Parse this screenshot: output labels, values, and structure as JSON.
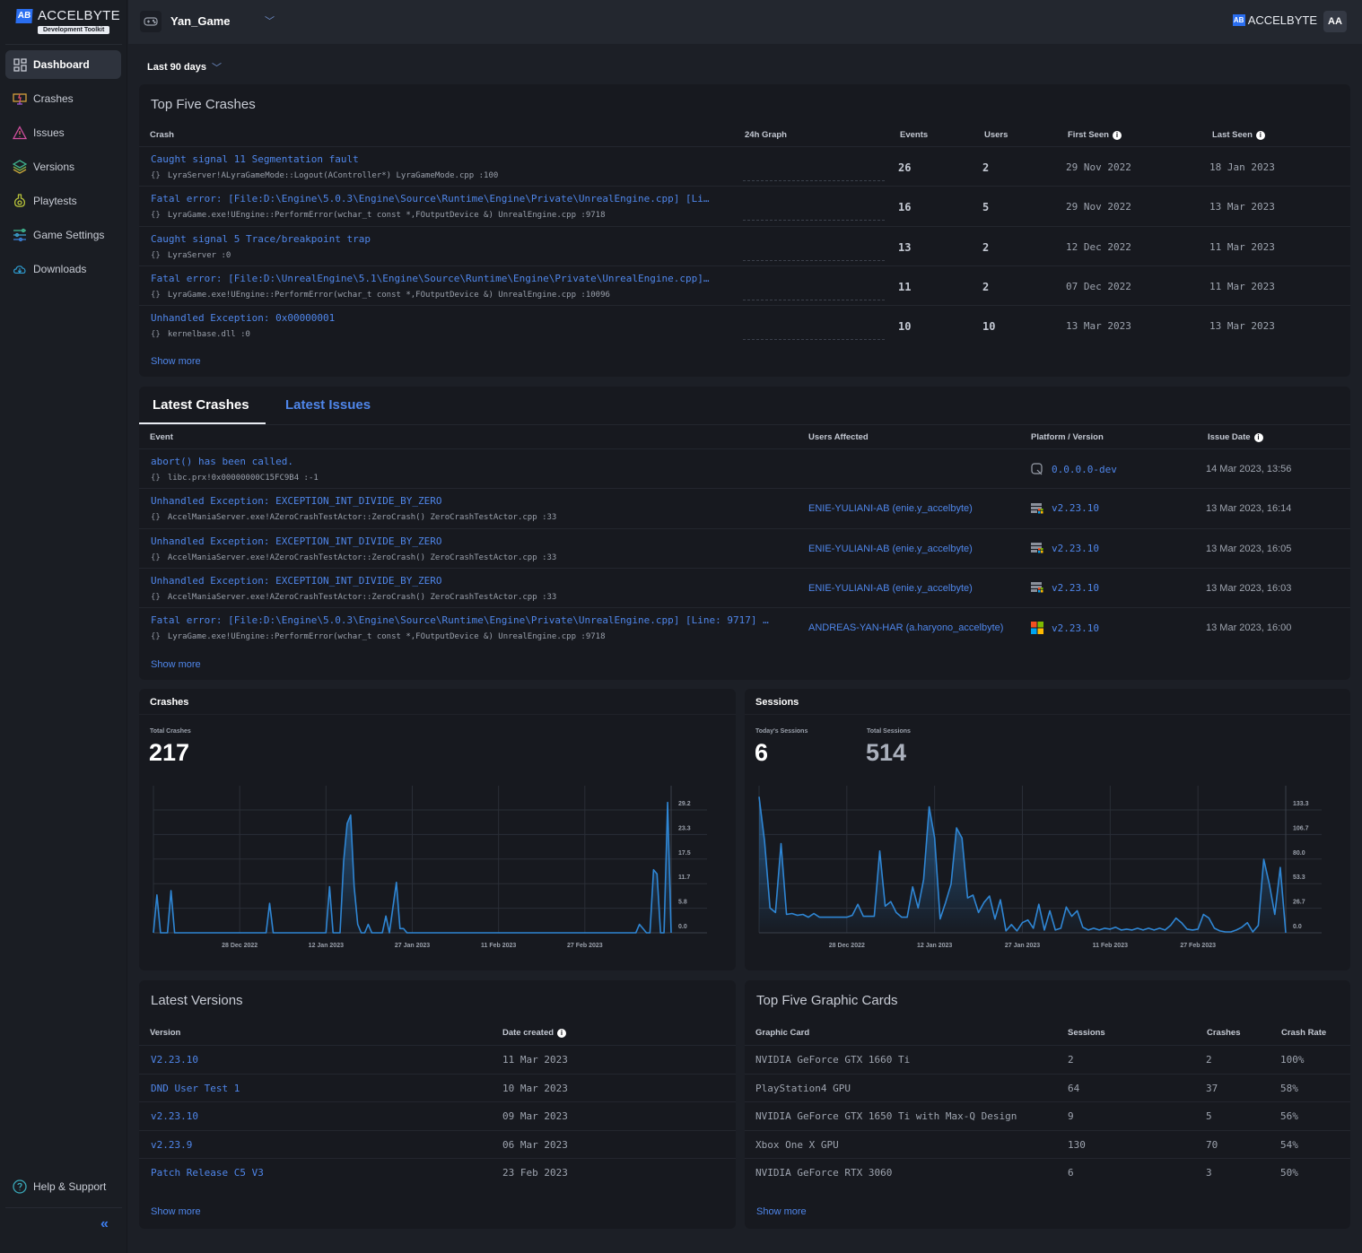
{
  "sidebar": {
    "brand": "ACCELBYTE",
    "brand_badge": "Development Toolkit",
    "items": [
      {
        "label": "Dashboard",
        "icon": "dashboard-icon",
        "active": true
      },
      {
        "label": "Crashes",
        "icon": "crashes-icon"
      },
      {
        "label": "Issues",
        "icon": "warning-icon"
      },
      {
        "label": "Versions",
        "icon": "layers-icon"
      },
      {
        "label": "Playtests",
        "icon": "flask-icon"
      },
      {
        "label": "Game Settings",
        "icon": "sliders-icon"
      },
      {
        "label": "Downloads",
        "icon": "cloud-download-icon"
      }
    ],
    "help": "Help & Support",
    "collapse": "«"
  },
  "topbar": {
    "game": "Yan_Game",
    "brand": "ACCELBYTE",
    "avatar": "AA"
  },
  "range": "Last 90 days",
  "top_crashes": {
    "title": "Top Five Crashes",
    "headers": {
      "crash": "Crash",
      "graph": "24h Graph",
      "events": "Events",
      "users": "Users",
      "first": "First Seen",
      "last": "Last Seen"
    },
    "rows": [
      {
        "title": "Caught signal 11 Segmentation fault",
        "sub": "LyraServer!ALyraGameMode::Logout(AController*) LyraGameMode.cpp :100",
        "events": "26",
        "users": "2",
        "first": "29 Nov 2022",
        "last": "18 Jan 2023"
      },
      {
        "title": "Fatal error: [File:D:\\Engine\\5.0.3\\Engine\\Source\\Runtime\\Engine\\Private\\UnrealEngine.cpp] [Li…",
        "sub": "LyraGame.exe!UEngine::PerformError(wchar_t const *,FOutputDevice &) UnrealEngine.cpp :9718",
        "events": "16",
        "users": "5",
        "first": "29 Nov 2022",
        "last": "13 Mar 2023"
      },
      {
        "title": "Caught signal 5 Trace/breakpoint trap",
        "sub": "LyraServer :0",
        "events": "13",
        "users": "2",
        "first": "12 Dec 2022",
        "last": "11 Mar 2023"
      },
      {
        "title": "Fatal error: [File:D:\\UnrealEngine\\5.1\\Engine\\Source\\Runtime\\Engine\\Private\\UnrealEngine.cpp]…",
        "sub": "LyraGame.exe!UEngine::PerformError(wchar_t const *,FOutputDevice &) UnrealEngine.cpp :10096",
        "events": "11",
        "users": "2",
        "first": "07 Dec 2022",
        "last": "11 Mar 2023"
      },
      {
        "title": "Unhandled Exception: 0x00000001",
        "sub": "kernelbase.dll :0",
        "events": "10",
        "users": "10",
        "first": "13 Mar 2023",
        "last": "13 Mar 2023"
      }
    ],
    "show_more": "Show more"
  },
  "latest": {
    "tabs": [
      "Latest Crashes",
      "Latest Issues"
    ],
    "headers": {
      "event": "Event",
      "users": "Users Affected",
      "platform": "Platform / Version",
      "date": "Issue Date"
    },
    "rows": [
      {
        "title": "abort() has been called.",
        "sub": "libc.prx!0x00000000C15FC9B4 :-1",
        "user": "",
        "platform": "playstation-icon",
        "version": "0.0.0.0-dev",
        "date": "14 Mar 2023, 13:56"
      },
      {
        "title": "Unhandled Exception: EXCEPTION_INT_DIVIDE_BY_ZERO",
        "sub": "AccelManiaServer.exe!AZeroCrashTestActor::ZeroCrash() ZeroCrashTestActor.cpp :33",
        "user": "ENIE-YULIANI-AB (enie.y_accelbyte)",
        "platform": "windows-server-icon",
        "version": "v2.23.10",
        "date": "13 Mar 2023, 16:14"
      },
      {
        "title": "Unhandled Exception: EXCEPTION_INT_DIVIDE_BY_ZERO",
        "sub": "AccelManiaServer.exe!AZeroCrashTestActor::ZeroCrash() ZeroCrashTestActor.cpp :33",
        "user": "ENIE-YULIANI-AB (enie.y_accelbyte)",
        "platform": "windows-server-icon",
        "version": "v2.23.10",
        "date": "13 Mar 2023, 16:05"
      },
      {
        "title": "Unhandled Exception: EXCEPTION_INT_DIVIDE_BY_ZERO",
        "sub": "AccelManiaServer.exe!AZeroCrashTestActor::ZeroCrash() ZeroCrashTestActor.cpp :33",
        "user": "ENIE-YULIANI-AB (enie.y_accelbyte)",
        "platform": "windows-server-icon",
        "version": "v2.23.10",
        "date": "13 Mar 2023, 16:03"
      },
      {
        "title": "Fatal error: [File:D:\\Engine\\5.0.3\\Engine\\Source\\Runtime\\Engine\\Private\\UnrealEngine.cpp] [Line: 9717] …",
        "sub": "LyraGame.exe!UEngine::PerformError(wchar_t const *,FOutputDevice &) UnrealEngine.cpp :9718",
        "user": "ANDREAS-YAN-HAR (a.haryono_accelbyte)",
        "platform": "windows-icon",
        "version": "v2.23.10",
        "date": "13 Mar 2023, 16:00"
      }
    ],
    "show_more": "Show more"
  },
  "crashes_panel": {
    "title": "Crashes",
    "total_label": "Total Crashes",
    "total": "217"
  },
  "sessions_panel": {
    "title": "Sessions",
    "today_label": "Today's Sessions",
    "today": "6",
    "total_label": "Total Sessions",
    "total": "514"
  },
  "chart_data": [
    {
      "type": "area",
      "title": "Crashes",
      "x_ticks": [
        "28 Dec 2022",
        "12 Jan 2023",
        "27 Jan 2023",
        "11 Feb 2023",
        "27 Feb 2023"
      ],
      "y_ticks": [
        "0.0",
        "5.8",
        "11.7",
        "17.5",
        "23.3",
        "29.2"
      ],
      "ylim": [
        0,
        35
      ],
      "grid": true,
      "color": "#2f86d4",
      "values": [
        0,
        9,
        0,
        0,
        0,
        10,
        0,
        0,
        0,
        0,
        0,
        0,
        0,
        0,
        0,
        0,
        0,
        0,
        0,
        0,
        0,
        0,
        0,
        0,
        0,
        0,
        0,
        0,
        0,
        0,
        0,
        0,
        0,
        7,
        0,
        0,
        0,
        0,
        0,
        0,
        0,
        0,
        0,
        0,
        0,
        0,
        0,
        0,
        0,
        0,
        11,
        0,
        0,
        0,
        17,
        26,
        28,
        11,
        2,
        0,
        0,
        2,
        0,
        0,
        0,
        0,
        4,
        0,
        6,
        12,
        1,
        1,
        0,
        0,
        0,
        0,
        0,
        0,
        0,
        0,
        0,
        0,
        0,
        0,
        0,
        0,
        0,
        0,
        0,
        0,
        0,
        0,
        0,
        0,
        0,
        0,
        0,
        0,
        0,
        0,
        0,
        0,
        0,
        0,
        0,
        0,
        0,
        0,
        0,
        0,
        0,
        0,
        0,
        0,
        0,
        0,
        0,
        0,
        0,
        0,
        0,
        0,
        0,
        0,
        0,
        0,
        0,
        0,
        0,
        0,
        0,
        0,
        0,
        0,
        0,
        0,
        0,
        0,
        2,
        1,
        0,
        0,
        15,
        14,
        0,
        0,
        31,
        0
      ]
    },
    {
      "type": "area",
      "title": "Sessions",
      "x_ticks": [
        "28 Dec 2022",
        "12 Jan 2023",
        "27 Jan 2023",
        "11 Feb 2023",
        "27 Feb 2023"
      ],
      "y_ticks": [
        "0.0",
        "26.7",
        "53.3",
        "80.0",
        "106.7",
        "133.3"
      ],
      "ylim": [
        0,
        160
      ],
      "grid": true,
      "color": "#2f86d4",
      "values": [
        148,
        100,
        27,
        22,
        97,
        20,
        21,
        19,
        20,
        17,
        21,
        17,
        17,
        17,
        17,
        17,
        17,
        19,
        31,
        18,
        18,
        18,
        89,
        29,
        34,
        22,
        17,
        17,
        50,
        27,
        58,
        137,
        103,
        15,
        33,
        53,
        114,
        103,
        38,
        41,
        22,
        33,
        40,
        15,
        36,
        2,
        9,
        2,
        11,
        14,
        5,
        31,
        3,
        24,
        3,
        5,
        28,
        18,
        24,
        6,
        3,
        5,
        3,
        5,
        4,
        6,
        3,
        4,
        3,
        5,
        3,
        5,
        3,
        5,
        3,
        8,
        16,
        11,
        4,
        3,
        4,
        20,
        16,
        5,
        2,
        1,
        1,
        3,
        6,
        11,
        1,
        8,
        80,
        53,
        20,
        71,
        0
      ]
    }
  ],
  "versions": {
    "title": "Latest Versions",
    "headers": {
      "version": "Version",
      "date": "Date created"
    },
    "rows": [
      {
        "version": "V2.23.10",
        "date": "11 Mar 2023"
      },
      {
        "version": "DND User Test 1",
        "date": "10 Mar 2023"
      },
      {
        "version": "v2.23.10",
        "date": "09 Mar 2023"
      },
      {
        "version": "v2.23.9",
        "date": "06 Mar 2023"
      },
      {
        "version": "Patch Release C5 V3",
        "date": "23 Feb 2023"
      }
    ],
    "show_more": "Show more"
  },
  "gpus": {
    "title": "Top Five Graphic Cards",
    "headers": {
      "card": "Graphic Card",
      "sessions": "Sessions",
      "crashes": "Crashes",
      "rate": "Crash Rate"
    },
    "rows": [
      {
        "card": "NVIDIA GeForce GTX 1660 Ti",
        "sessions": "2",
        "crashes": "2",
        "rate": "100%"
      },
      {
        "card": "PlayStation4 GPU",
        "sessions": "64",
        "crashes": "37",
        "rate": "58%"
      },
      {
        "card": "NVIDIA GeForce GTX 1650 Ti with Max-Q Design",
        "sessions": "9",
        "crashes": "5",
        "rate": "56%"
      },
      {
        "card": "Xbox One X GPU",
        "sessions": "130",
        "crashes": "70",
        "rate": "54%"
      },
      {
        "card": "NVIDIA GeForce RTX 3060",
        "sessions": "6",
        "crashes": "3",
        "rate": "50%"
      }
    ],
    "show_more": "Show more"
  }
}
